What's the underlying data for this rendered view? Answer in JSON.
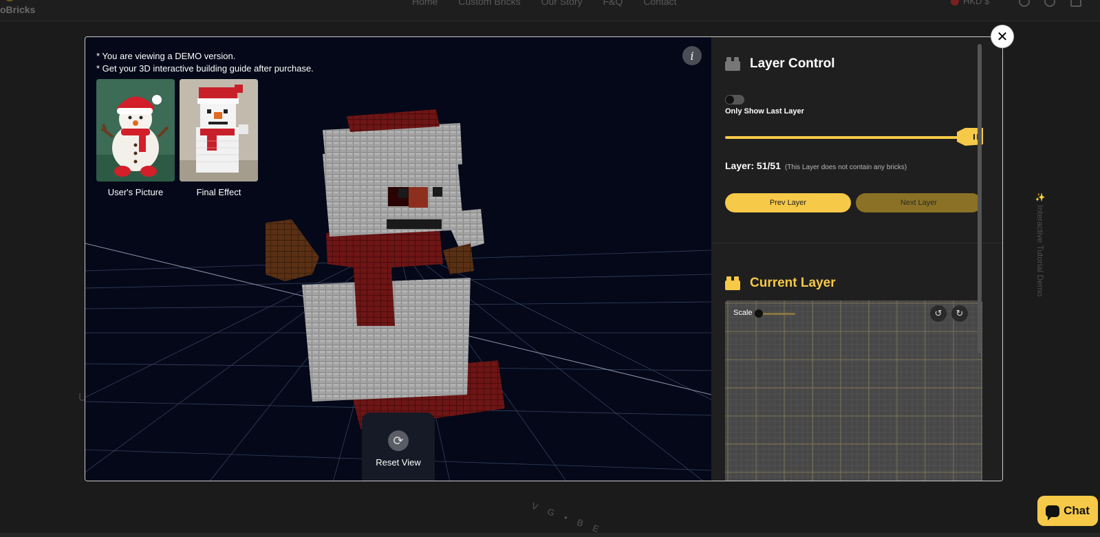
{
  "background": {
    "logo": "oBricks",
    "nav": [
      "Home",
      "Custom Bricks",
      "Our Story",
      "F&Q",
      "Contact"
    ],
    "currency": "HKD $",
    "side_text": "✨ Interactive Tutorial Demo",
    "partial_text": "U",
    "circle_text": "V G • B E"
  },
  "chat": {
    "label": "Chat"
  },
  "viewer": {
    "demo_lines": [
      "* You are viewing a DEMO version.",
      "* Get your 3D interactive building guide after purchase."
    ],
    "thumb_user_label": "User's Picture",
    "thumb_final_label": "Final Effect",
    "reset_label": "Reset View",
    "info_glyph": "i"
  },
  "panel": {
    "layer_control_title": "Layer Control",
    "toggle_label": "Only Show Last Layer",
    "toggle_on": false,
    "layer_current": 51,
    "layer_total": 51,
    "layer_text": "Layer: 51/51",
    "layer_note": "(This Layer does not contain any bricks)",
    "prev_label": "Prev Layer",
    "next_label": "Next Layer",
    "current_layer_title": "Current Layer",
    "scale_label": "Scale",
    "accent_color": "#f7c948"
  }
}
